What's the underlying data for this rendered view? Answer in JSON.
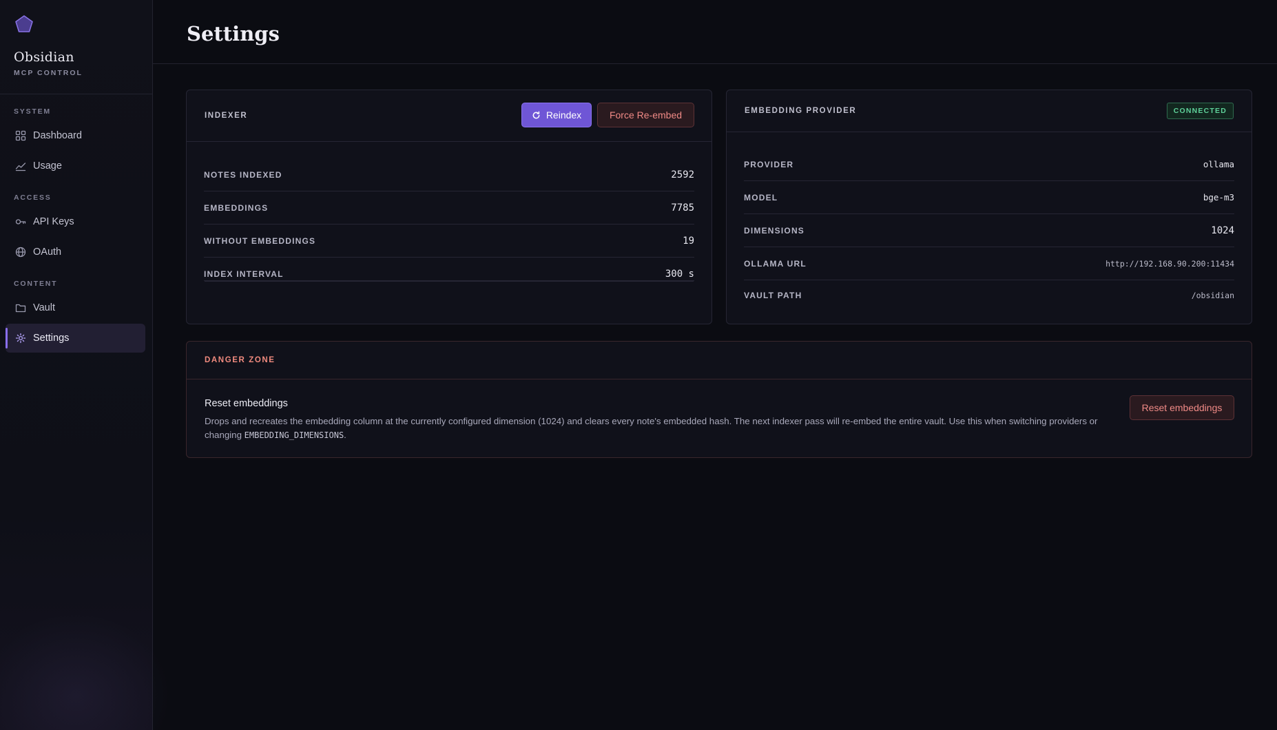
{
  "brand": {
    "name": "Obsidian",
    "subtitle": "MCP CONTROL",
    "logo_icon": "pentagon-icon",
    "accent_color": "#8a6ff0"
  },
  "sidebar": {
    "sections": [
      {
        "label": "SYSTEM"
      },
      {
        "label": "ACCESS"
      },
      {
        "label": "CONTENT"
      }
    ],
    "items": [
      {
        "label": "Dashboard",
        "icon": "grid-icon"
      },
      {
        "label": "Usage",
        "icon": "chart-line-icon"
      },
      {
        "label": "API Keys",
        "icon": "key-icon"
      },
      {
        "label": "OAuth",
        "icon": "globe-icon"
      },
      {
        "label": "Vault",
        "icon": "folder-icon"
      },
      {
        "label": "Settings",
        "icon": "gear-icon",
        "active": true
      }
    ]
  },
  "header": {
    "title": "Settings"
  },
  "indexer": {
    "title": "INDEXER",
    "reindex_label": "Reindex",
    "force_reembed_label": "Force Re-embed",
    "rows": [
      {
        "label": "NOTES INDEXED",
        "value": "2592"
      },
      {
        "label": "EMBEDDINGS",
        "value": "7785"
      },
      {
        "label": "WITHOUT EMBEDDINGS",
        "value": "19"
      },
      {
        "label": "INDEX INTERVAL",
        "value": "300 s"
      }
    ]
  },
  "embedding": {
    "title": "EMBEDDING PROVIDER",
    "status": "CONNECTED",
    "status_color": "#5fd19a",
    "rows": [
      {
        "label": "PROVIDER",
        "value": "ollama"
      },
      {
        "label": "MODEL",
        "value": "bge-m3"
      },
      {
        "label": "DIMENSIONS",
        "value": "1024"
      },
      {
        "label": "OLLAMA URL",
        "value": "http://192.168.90.200:11434"
      },
      {
        "label": "VAULT PATH",
        "value": "/obsidian"
      }
    ]
  },
  "danger_zone": {
    "title": "DANGER ZONE",
    "heading": "Reset embeddings",
    "description_pre": "Drops and recreates the embedding column at the currently configured dimension (1024) and clears every note's embedded hash. The next indexer pass will re-embed the entire vault. Use this when switching providers or changing ",
    "description_code": "EMBEDDING_DIMENSIONS",
    "description_post": ".",
    "button_label": "Reset embeddings",
    "color": "#f08a7e"
  }
}
